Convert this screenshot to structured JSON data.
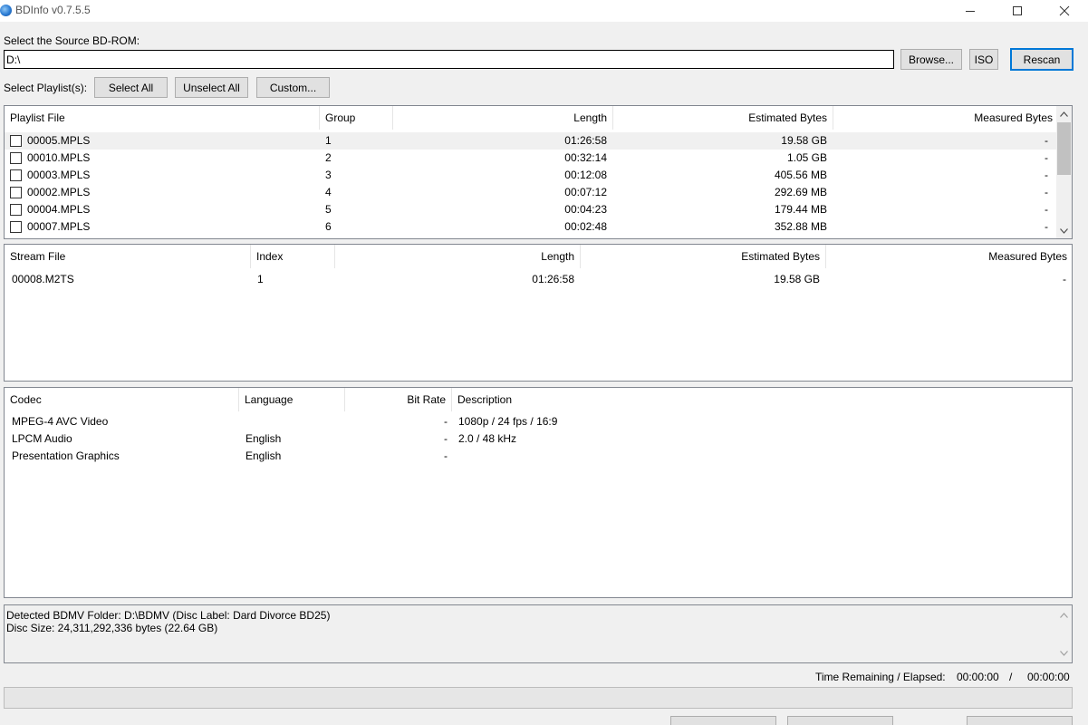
{
  "window": {
    "title": "BDInfo v0.7.5.5"
  },
  "source": {
    "label": "Select the Source BD-ROM:",
    "path": "D:\\",
    "browse_label": "Browse...",
    "iso_label": "ISO",
    "rescan_label": "Rescan"
  },
  "playlist_select": {
    "label": "Select Playlist(s):",
    "select_all_label": "Select All",
    "unselect_all_label": "Unselect All",
    "custom_label": "Custom..."
  },
  "playlists": {
    "headers": {
      "file": "Playlist File",
      "group": "Group",
      "length": "Length",
      "estimated": "Estimated Bytes",
      "measured": "Measured Bytes"
    },
    "rows": [
      {
        "file": "00005.MPLS",
        "group": "1",
        "length": "01:26:58",
        "estimated": "19.58 GB",
        "measured": "-",
        "checked": false
      },
      {
        "file": "00010.MPLS",
        "group": "2",
        "length": "00:32:14",
        "estimated": "1.05 GB",
        "measured": "-",
        "checked": false
      },
      {
        "file": "00003.MPLS",
        "group": "3",
        "length": "00:12:08",
        "estimated": "405.56 MB",
        "measured": "-",
        "checked": false
      },
      {
        "file": "00002.MPLS",
        "group": "4",
        "length": "00:07:12",
        "estimated": "292.69 MB",
        "measured": "-",
        "checked": false
      },
      {
        "file": "00004.MPLS",
        "group": "5",
        "length": "00:04:23",
        "estimated": "179.44 MB",
        "measured": "-",
        "checked": false
      },
      {
        "file": "00007.MPLS",
        "group": "6",
        "length": "00:02:48",
        "estimated": "352.88 MB",
        "measured": "-",
        "checked": false
      }
    ]
  },
  "streams": {
    "headers": {
      "file": "Stream File",
      "index": "Index",
      "length": "Length",
      "estimated": "Estimated Bytes",
      "measured": "Measured Bytes"
    },
    "rows": [
      {
        "file": "00008.M2TS",
        "index": "1",
        "length": "01:26:58",
        "estimated": "19.58 GB",
        "measured": "-"
      }
    ]
  },
  "codecs": {
    "headers": {
      "codec": "Codec",
      "language": "Language",
      "bitrate": "Bit Rate",
      "description": "Description"
    },
    "rows": [
      {
        "codec": "MPEG-4 AVC Video",
        "language": "",
        "bitrate": "-",
        "description": "1080p / 24 fps / 16:9"
      },
      {
        "codec": "LPCM Audio",
        "language": "English",
        "bitrate": "-",
        "description": "2.0 / 48 kHz"
      },
      {
        "codec": "Presentation Graphics",
        "language": "English",
        "bitrate": "-",
        "description": ""
      }
    ]
  },
  "status": {
    "line1": "Detected BDMV Folder: D:\\BDMV (Disc Label: Dard Divorce BD25)",
    "line2": "Disc Size: 24,311,292,336 bytes (22.64 GB)"
  },
  "timer": {
    "label": "Time Remaining / Elapsed:",
    "remaining": "00:00:00",
    "separator": "/",
    "elapsed": "00:00:00"
  },
  "progress": {
    "value": 0
  },
  "colors": {
    "accent": "#0078d7",
    "progress_fill": "#06b025"
  }
}
